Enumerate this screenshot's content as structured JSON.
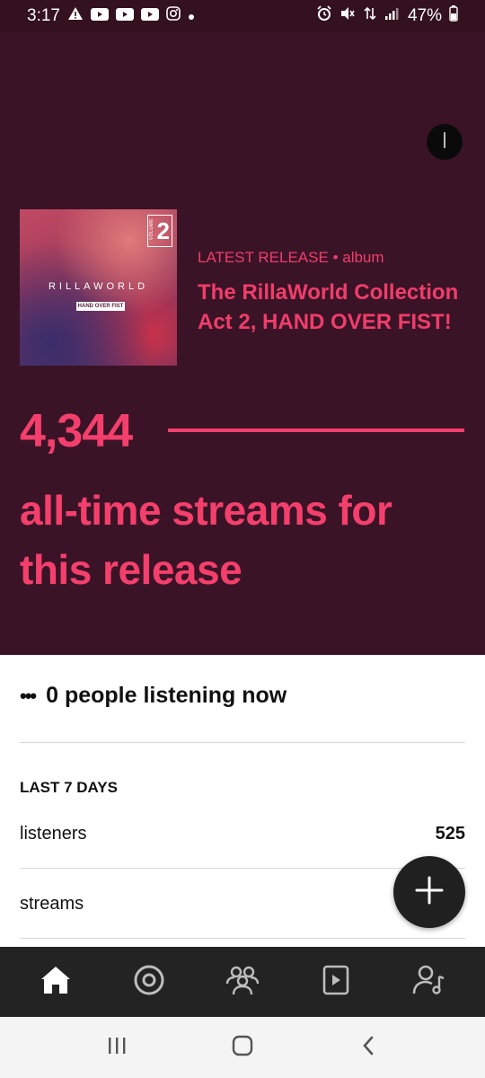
{
  "status_bar": {
    "time": "3:17",
    "battery": "47%",
    "icons_left": [
      "warning-icon",
      "youtube-icon",
      "youtube-icon",
      "youtube-icon",
      "instagram-icon",
      "dot-icon"
    ],
    "icons_right": [
      "alarm-icon",
      "mute-icon",
      "data-icon",
      "signal-icon",
      "battery-icon"
    ]
  },
  "release": {
    "cover": {
      "brand": "RILLAWORLD",
      "subtitle": "HAND OVER FIST",
      "volume_word": "VOLUME",
      "volume_number": "2"
    },
    "label": "LATEST RELEASE",
    "separator": "•",
    "type": "album",
    "title": "The RillaWorld Collection Act 2, HAND OVER FIST!"
  },
  "streams": {
    "count": "4,344",
    "caption": "all-time streams for this release"
  },
  "listening": {
    "dots": "•••",
    "text": "0 people listening now"
  },
  "last7": {
    "title": "LAST 7 DAYS",
    "rows": [
      {
        "label": "listeners",
        "value": "525"
      },
      {
        "label": "streams",
        "value": ""
      }
    ]
  },
  "bottom_nav": {
    "items": [
      "home-icon",
      "releases-icon",
      "audience-icon",
      "playlist-icon",
      "artist-icon"
    ],
    "active": "home-icon"
  },
  "colors": {
    "hero_bg": "#3b1326",
    "accent": "#f43f6d",
    "status_bg": "#34111f",
    "nav_bg": "#232323"
  }
}
